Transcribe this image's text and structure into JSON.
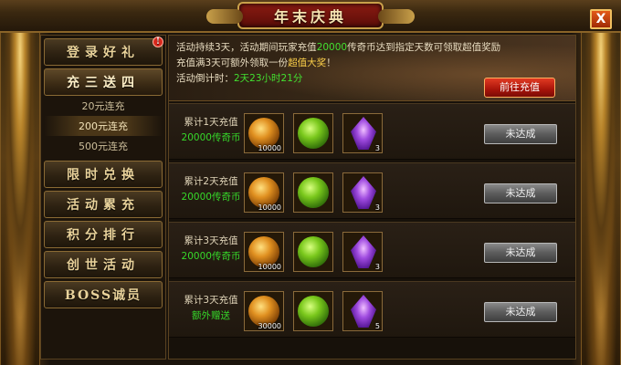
{
  "window": {
    "title": "年末庆典",
    "close_label": "X"
  },
  "menu": {
    "items": [
      {
        "label": "登录好礼",
        "badge": "!"
      },
      {
        "label": "充三送四"
      },
      {
        "label": "限时兑换"
      },
      {
        "label": "活动累充"
      },
      {
        "label": "积分排行"
      },
      {
        "label": "创世活动"
      },
      {
        "label": "BOSS诚员"
      }
    ],
    "sub_items": [
      "20元连充",
      "200元连充",
      "500元连充"
    ],
    "active_index": 1,
    "selected_sub_index": 1
  },
  "banner": {
    "line1_a": "活动持续3天，活动期间玩家充值",
    "line1_highlight": "20000",
    "line1_b": "传奇币达到指定天数可领取超值奖励",
    "line2_a": "充值满3天可额外领取一份",
    "line2_highlight": "超值大奖",
    "line2_b": "！",
    "countdown_label": "活动倒计时：",
    "countdown_value": "2天23小时21分",
    "recharge_button": "前往充值"
  },
  "rows": [
    {
      "title": "累计1天充值",
      "amount": "20000传奇币",
      "items": [
        {
          "name": "coin-icon",
          "count": "10000"
        },
        {
          "name": "jade-icon",
          "count": ""
        },
        {
          "name": "crystal-icon",
          "count": "3"
        }
      ],
      "status": "未达成"
    },
    {
      "title": "累计2天充值",
      "amount": "20000传奇币",
      "items": [
        {
          "name": "coin-icon",
          "count": "10000"
        },
        {
          "name": "jade-icon",
          "count": ""
        },
        {
          "name": "crystal-icon",
          "count": "3"
        }
      ],
      "status": "未达成"
    },
    {
      "title": "累计3天充值",
      "amount": "20000传奇币",
      "items": [
        {
          "name": "coin-icon",
          "count": "10000"
        },
        {
          "name": "jade-icon",
          "count": ""
        },
        {
          "name": "crystal-icon",
          "count": "3"
        }
      ],
      "status": "未达成"
    },
    {
      "title": "累计3天充值",
      "amount": "额外赠送",
      "items": [
        {
          "name": "coin-icon",
          "count": "30000"
        },
        {
          "name": "jade-icon",
          "count": ""
        },
        {
          "name": "crystal-icon",
          "count": "5"
        }
      ],
      "status": "未达成"
    }
  ],
  "colors": {
    "highlight_green": "#42e030",
    "highlight_gold": "#ffd24a",
    "accent_red": "#a8140a"
  }
}
